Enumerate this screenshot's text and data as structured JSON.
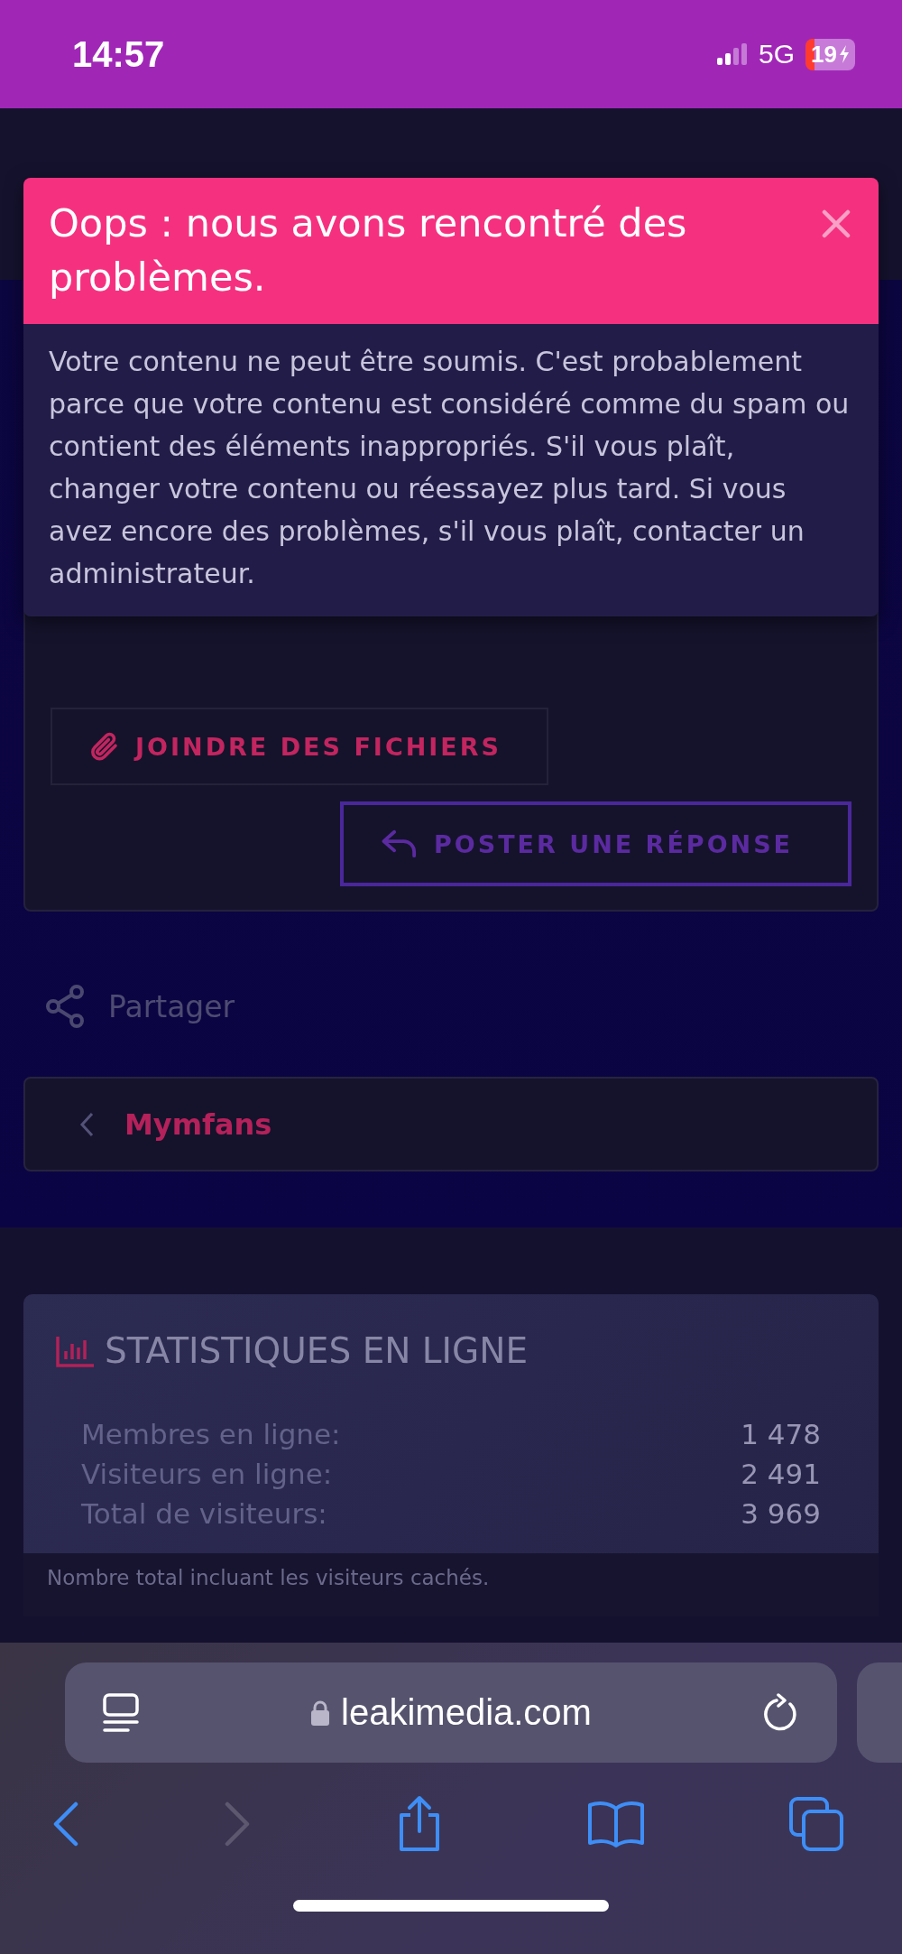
{
  "status_bar": {
    "time": "14:57",
    "network": "5G",
    "battery": "19"
  },
  "alert": {
    "title": "Oops : nous avons rencontré des problèmes.",
    "message": "Votre contenu ne peut être soumis. C'est probablement parce que votre contenu est considéré comme du spam ou contient des éléments inappropriés. S'il vous plaît, changer votre contenu ou réessayez plus tard. Si vous avez encore des problèmes, s'il vous plaît, contacter un administrateur."
  },
  "actions": [
    {
      "label": "JOINDRE DES FICHIERS",
      "kind": "attach"
    },
    {
      "label": "POSTER UNE RÉPONSE",
      "kind": "reply"
    }
  ],
  "share": {
    "label": "Partager"
  },
  "breadcrumb": {
    "label": "Mymfans"
  },
  "stats": {
    "title": "STATISTIQUES EN LIGNE",
    "rows": [
      {
        "label": "Membres en ligne:",
        "value": "1 478"
      },
      {
        "label": "Visiteurs en ligne:",
        "value": "2 491"
      },
      {
        "label": "Total de visiteurs:",
        "value": "3 969"
      }
    ],
    "footnote": "Nombre total incluant les visiteurs cachés."
  },
  "browser": {
    "url": "leakimedia.com"
  }
}
